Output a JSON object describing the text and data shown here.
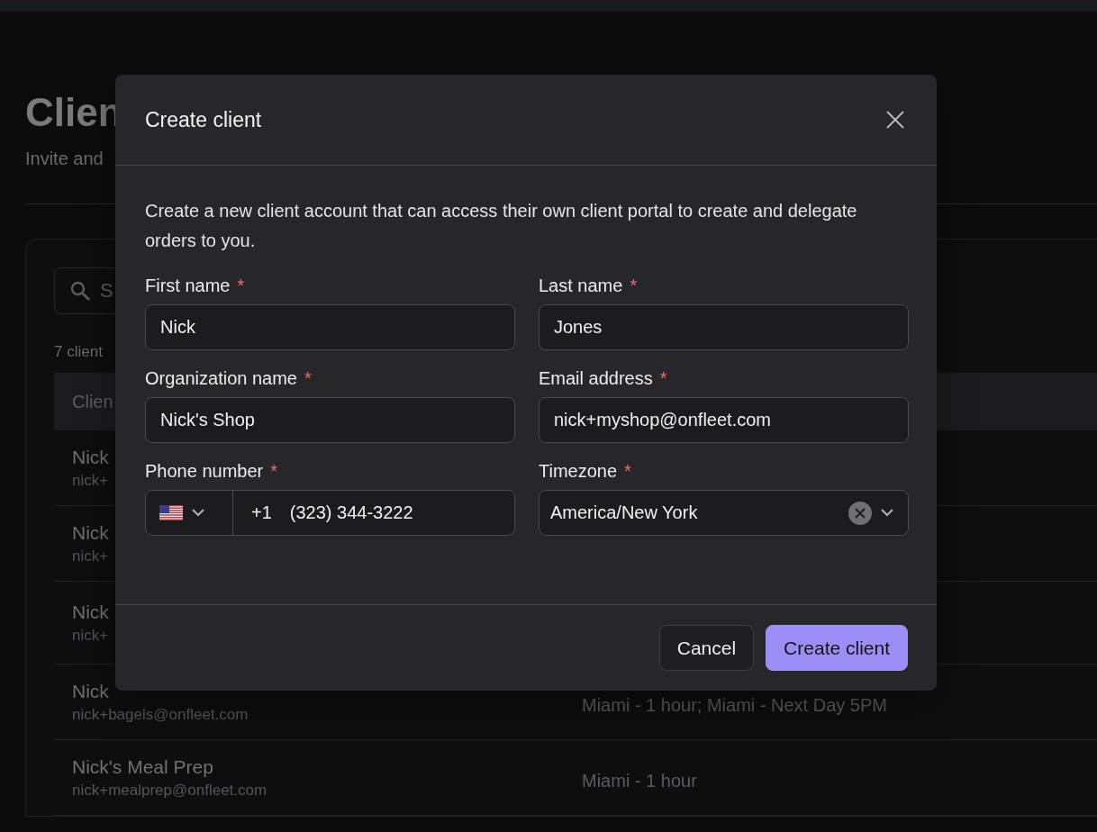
{
  "page": {
    "title": "Clien",
    "subtitle": "Invite and",
    "search": {
      "placeholder": "S"
    },
    "count": "7 client",
    "table": {
      "columns": [
        "Clien"
      ],
      "rows": [
        {
          "name": "Nick",
          "email": "nick+"
        },
        {
          "name": "Nick",
          "email": "nick+"
        },
        {
          "name": "Nick",
          "email": "nick+"
        },
        {
          "name": "Nick",
          "email": "nick+bagels@onfleet.com",
          "zones": "Miami - 1 hour; Miami - Next Day 5PM"
        },
        {
          "name": "Nick's Meal Prep",
          "email": "nick+mealprep@onfleet.com",
          "zones": "Miami - 1 hour"
        }
      ]
    }
  },
  "dialog": {
    "title": "Create client",
    "description": "Create a new client account that can access their own client portal to create and delegate orders to you.",
    "fields": [
      {
        "kind": "text",
        "label": "First name",
        "required_mark": "*",
        "value": "Nick"
      },
      {
        "kind": "text",
        "label": "Last name",
        "required_mark": "*",
        "value": "Jones"
      },
      {
        "kind": "text",
        "label": "Organization name",
        "required_mark": "*",
        "value": "Nick's Shop"
      },
      {
        "kind": "text",
        "label": "Email address",
        "required_mark": "*",
        "value": "nick+myshop@onfleet.com"
      },
      {
        "kind": "phone",
        "label": "Phone number",
        "required_mark": "*",
        "country_code": "+1",
        "value": "(323) 344-3222"
      },
      {
        "kind": "select",
        "label": "Timezone",
        "required_mark": "*",
        "value": "America/New York"
      }
    ],
    "buttons": [
      {
        "kind": "secondary",
        "label": "Cancel"
      },
      {
        "kind": "primary",
        "label": "Create client"
      }
    ]
  }
}
